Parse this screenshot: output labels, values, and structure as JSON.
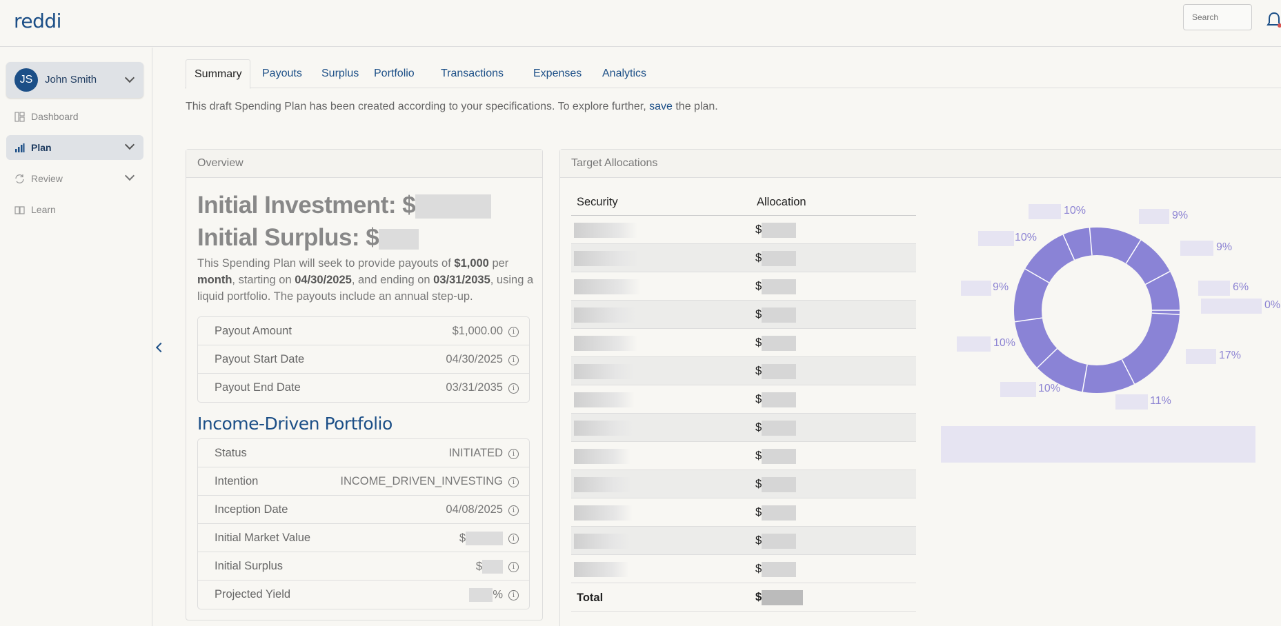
{
  "app": {
    "logo": "reddi"
  },
  "search": {
    "placeholder": "Search"
  },
  "sidebar": {
    "user": {
      "initials": "JS",
      "name": "John Smith"
    },
    "items": [
      {
        "label": "Dashboard",
        "icon": "dashboard-icon"
      },
      {
        "label": "Plan",
        "icon": "bar-chart-icon",
        "active": true
      },
      {
        "label": "Review",
        "icon": "refresh-icon"
      },
      {
        "label": "Learn",
        "icon": "book-icon"
      }
    ]
  },
  "tabs": [
    "Summary",
    "Payouts",
    "Surplus",
    "Portfolio",
    "Transactions",
    "Expenses",
    "Analytics"
  ],
  "notice": {
    "before": "This draft Spending Plan has been created according to your specifications. To explore further, ",
    "link": "save",
    "after": " the plan."
  },
  "overview": {
    "title": "Overview",
    "initial_investment_label": "Initial Investment: $",
    "initial_surplus_label": "Initial Surplus: $",
    "desc": {
      "p1": "This Spending Plan will seek to provide payouts of ",
      "amount": "$1,000",
      "p2": " per ",
      "freq": "month",
      "p3": ", starting on ",
      "start": "04/30/2025",
      "p4": ", and ending on ",
      "end": "03/31/2035",
      "p5": ", using a liquid portfolio. The payouts include an annual step-up."
    },
    "payout_rows": [
      {
        "label": "Payout Amount",
        "value": "$1,000.00"
      },
      {
        "label": "Payout Start Date",
        "value": "04/30/2025"
      },
      {
        "label": "Payout End Date",
        "value": "03/31/2035"
      }
    ],
    "portfolio_title": "Income-Driven Portfolio",
    "portfolio_rows": [
      {
        "label": "Status",
        "value": "INITIATED"
      },
      {
        "label": "Intention",
        "value": "INCOME_DRIVEN_INVESTING"
      },
      {
        "label": "Inception Date",
        "value": "04/08/2025"
      },
      {
        "label": "Initial Market Value",
        "value": "$"
      },
      {
        "label": "Initial Surplus",
        "value": "$"
      },
      {
        "label": "Projected Yield",
        "value": "%"
      }
    ]
  },
  "allocations": {
    "title": "Target Allocations",
    "col_security": "Security",
    "col_allocation": "Allocation",
    "currency": "$",
    "total_label": "Total",
    "donut_percents": [
      "10%",
      "9%",
      "9%",
      "6%",
      "0%",
      "17%",
      "11%",
      "10%",
      "10%",
      "9%",
      "10%"
    ],
    "colors": {
      "donut": "#8a83d6",
      "label": "#8d84d3"
    }
  }
}
